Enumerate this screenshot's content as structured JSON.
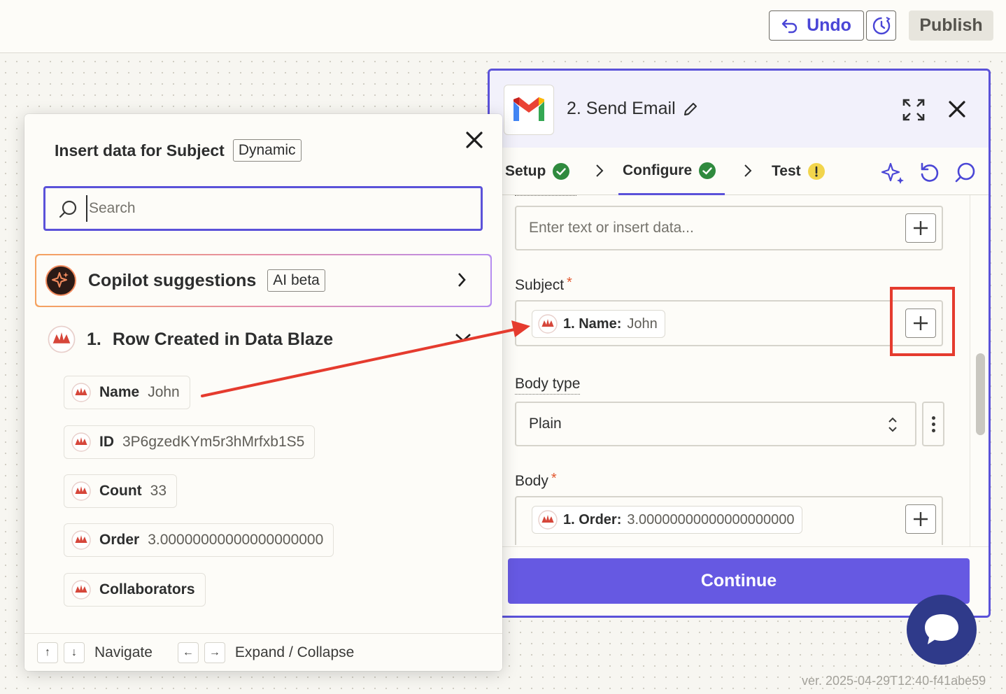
{
  "topbar": {
    "undo_label": "Undo",
    "publish_label": "Publish"
  },
  "editor": {
    "step_title": "2. Send Email",
    "tabs": [
      {
        "label": "Setup",
        "status": "complete"
      },
      {
        "label": "Configure",
        "status": "complete"
      },
      {
        "label": "Test",
        "status": "warning"
      }
    ],
    "fields": {
      "first_placeholder": "Enter text or insert data...",
      "subject_label": "Subject",
      "subject_pill_key": "1. Name:",
      "subject_pill_value": "John",
      "body_type_label": "Body type",
      "body_type_value": "Plain",
      "body_label": "Body",
      "body_pill_key": "1. Order:",
      "body_pill_value": "3.00000000000000000000"
    },
    "continue_label": "Continue"
  },
  "popover": {
    "title": "Insert data for Subject",
    "title_badge": "Dynamic",
    "search_placeholder": "Search",
    "search_value": "",
    "copilot_label": "Copilot suggestions",
    "copilot_badge": "AI beta",
    "group_number": "1.",
    "group_title": "Row Created in Data Blaze",
    "items": [
      {
        "key": "Name",
        "value": "John"
      },
      {
        "key": "ID",
        "value": "3P6gzedKYm5r3hMrfxb1S5"
      },
      {
        "key": "Count",
        "value": "33"
      },
      {
        "key": "Order",
        "value": "3.00000000000000000000"
      },
      {
        "key": "Collaborators",
        "value": ""
      }
    ],
    "footer": {
      "navigate_label": "Navigate",
      "expand_label": "Expand / Collapse"
    }
  },
  "version": "ver. 2025-04-29T12:40-f41abe59",
  "colors": {
    "accent": "#5b52d9",
    "continue": "#6659e2",
    "success": "#2f8a3e",
    "warning": "#f2d54c",
    "annotation": "#e53b2e",
    "chat": "#2f3a8a"
  }
}
